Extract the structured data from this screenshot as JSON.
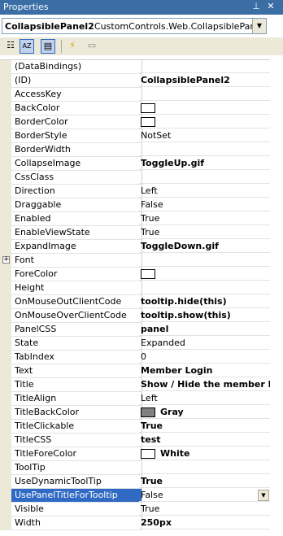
{
  "window": {
    "title": "Properties",
    "pin_glyph": "⊥",
    "close_glyph": "✕"
  },
  "selector": {
    "control_name": "CollapsiblePanel2",
    "control_type": "CustomControls.Web.CollapsiblePanel",
    "drop_glyph": "▼"
  },
  "toolbar": {
    "categorized_glyph": "☷",
    "alphabetical_glyph": "AZ",
    "properties_glyph": "▤",
    "events_glyph": "⚡",
    "property_pages_glyph": "▭"
  },
  "grid": {
    "expander_glyph": "+",
    "dropdown_glyph": "▼",
    "rows": [
      {
        "name": "(DataBindings)",
        "value": ""
      },
      {
        "name": "(ID)",
        "value": "CollapsiblePanel2",
        "bold": true
      },
      {
        "name": "AccessKey",
        "value": ""
      },
      {
        "name": "BackColor",
        "value": "",
        "swatch": "#ffffff"
      },
      {
        "name": "BorderColor",
        "value": "",
        "swatch": "#ffffff"
      },
      {
        "name": "BorderStyle",
        "value": "NotSet"
      },
      {
        "name": "BorderWidth",
        "value": ""
      },
      {
        "name": "CollapseImage",
        "value": "ToggleUp.gif",
        "bold": true
      },
      {
        "name": "CssClass",
        "value": ""
      },
      {
        "name": "Direction",
        "value": "Left"
      },
      {
        "name": "Draggable",
        "value": "False"
      },
      {
        "name": "Enabled",
        "value": "True"
      },
      {
        "name": "EnableViewState",
        "value": "True"
      },
      {
        "name": "ExpandImage",
        "value": "ToggleDown.gif",
        "bold": true
      },
      {
        "name": "Font",
        "value": "",
        "expandable": true
      },
      {
        "name": "ForeColor",
        "value": "",
        "swatch": "#ffffff"
      },
      {
        "name": "Height",
        "value": ""
      },
      {
        "name": "OnMouseOutClientCode",
        "value": "tooltip.hide(this)",
        "bold": true
      },
      {
        "name": "OnMouseOverClientCode",
        "value": "tooltip.show(this)",
        "bold": true
      },
      {
        "name": "PanelCSS",
        "value": "panel",
        "bold": true
      },
      {
        "name": "State",
        "value": "Expanded"
      },
      {
        "name": "TabIndex",
        "value": "0"
      },
      {
        "name": "Text",
        "value": "Member Login",
        "bold": true
      },
      {
        "name": "Title",
        "value": "Show / Hide the member log",
        "bold": true
      },
      {
        "name": "TitleAlign",
        "value": "Left"
      },
      {
        "name": "TitleBackColor",
        "value": "Gray",
        "bold": true,
        "swatch": "#808080"
      },
      {
        "name": "TitleClickable",
        "value": "True",
        "bold": true
      },
      {
        "name": "TitleCSS",
        "value": "test",
        "bold": true
      },
      {
        "name": "TitleForeColor",
        "value": "White",
        "bold": true,
        "swatch": "#ffffff"
      },
      {
        "name": "ToolTip",
        "value": ""
      },
      {
        "name": "UseDynamicToolTip",
        "value": "True",
        "bold": true
      },
      {
        "name": "UsePanelTitleForTooltip",
        "value": "False",
        "selected": true,
        "dropdown": true
      },
      {
        "name": "Visible",
        "value": "True"
      },
      {
        "name": "Width",
        "value": "250px",
        "bold": true
      }
    ]
  },
  "colors": {
    "titlebar": "#3a6ea5",
    "selection": "#316ac5",
    "chrome": "#ece9d8"
  }
}
